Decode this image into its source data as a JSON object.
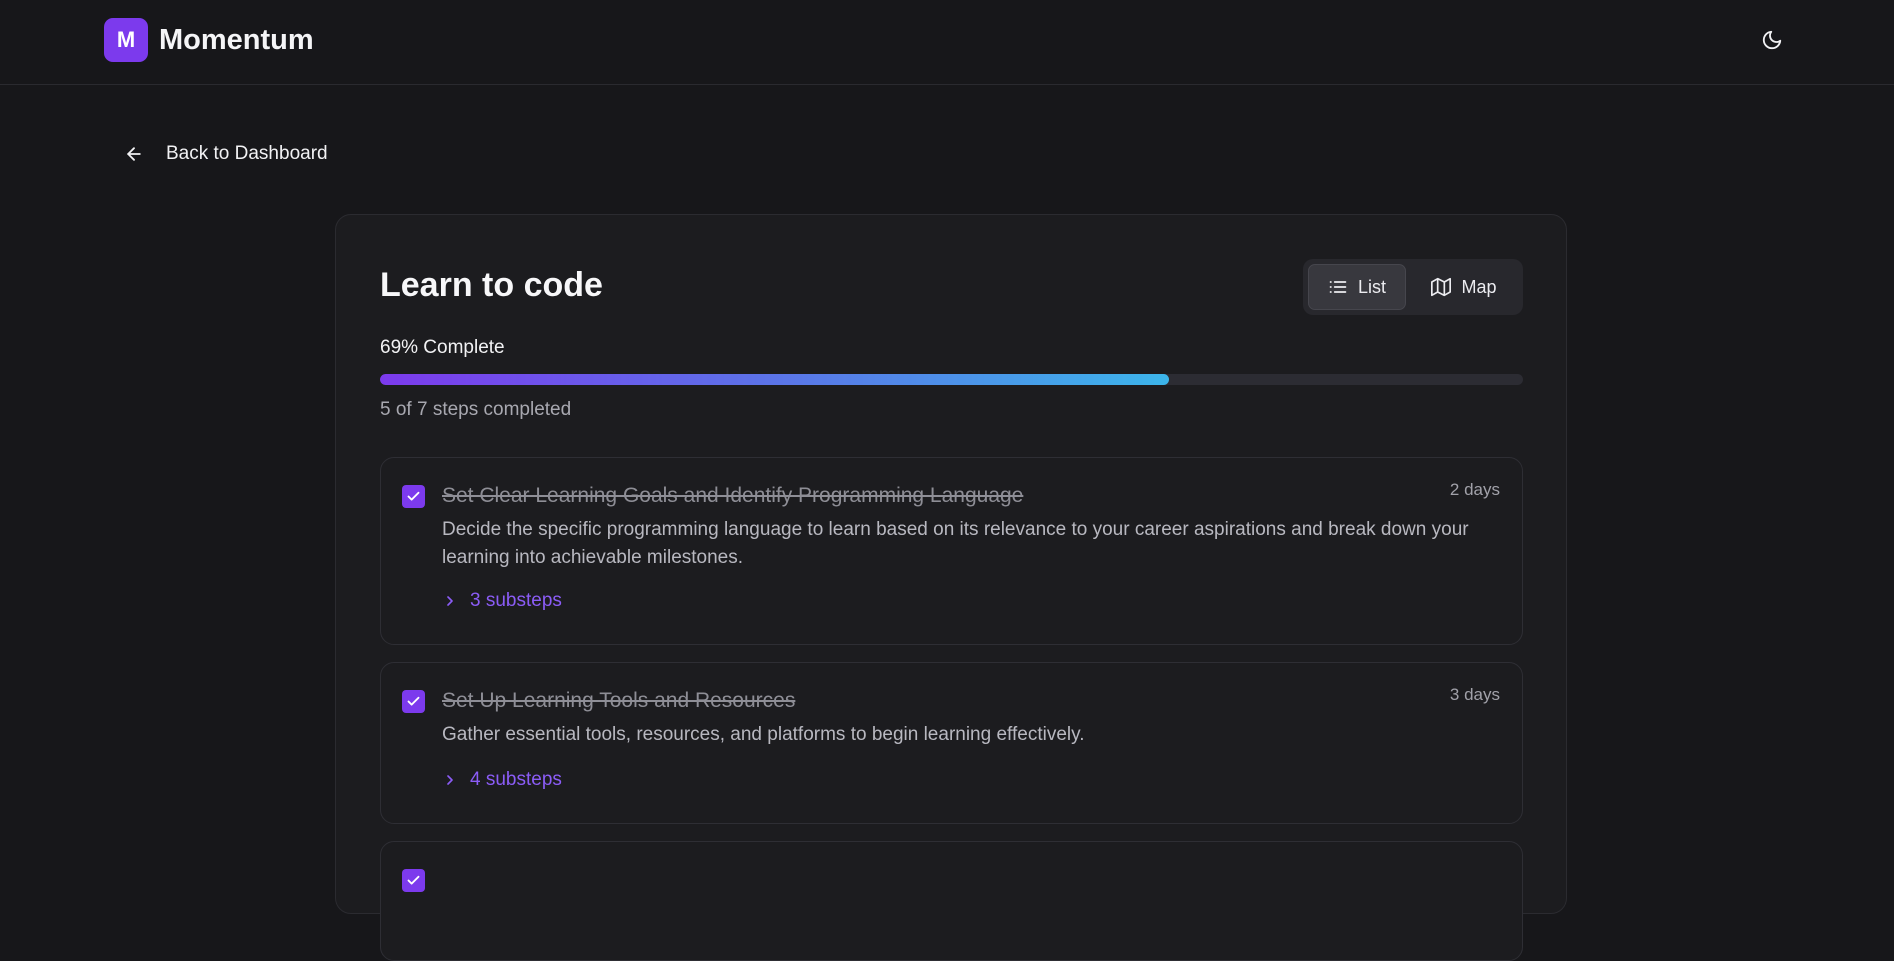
{
  "app": {
    "logo_letter": "M",
    "name": "Momentum"
  },
  "header": {
    "theme_icon": "moon-icon"
  },
  "nav": {
    "back_label": "Back to Dashboard"
  },
  "goal": {
    "title": "Learn to code",
    "progress_label": "69% Complete",
    "progress_value": 0.69,
    "steps_summary": "5 of 7 steps completed"
  },
  "view_toggle": {
    "list_label": "List",
    "map_label": "Map",
    "selected": "List"
  },
  "steps": [
    {
      "title": "Set Clear Learning Goals and Identify Programming Language",
      "duration": "2 days",
      "description": "Decide the specific programming language to learn based on its relevance to your career aspirations and break down your learning into achievable milestones.",
      "substeps_label": "3 substeps",
      "completed": true
    },
    {
      "title": "Set Up Learning Tools and Resources",
      "duration": "3 days",
      "description": "Gather essential tools, resources, and platforms to begin learning effectively.",
      "substeps_label": "4 substeps",
      "completed": true
    }
  ],
  "colors": {
    "accent": "#7c3aed",
    "background": "#17171a",
    "card": "#1c1c1f"
  }
}
